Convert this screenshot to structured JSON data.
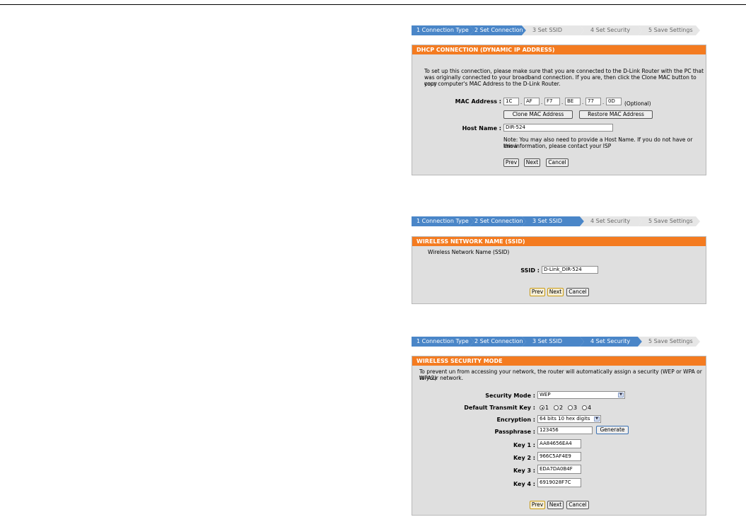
{
  "wizard_steps": [
    "1 Connection Type",
    "2 Set Connection",
    "3 Set SSID",
    "4 Set Security",
    "5 Save Settings"
  ],
  "colors": {
    "accent": "#f47b20",
    "step_active": "#4a86c8",
    "step_inactive": "#e6e6e6",
    "panel_bg": "#dfdfdf"
  },
  "dhcp": {
    "title": "DHCP CONNECTION (DYNAMIC IP ADDRESS)",
    "intro_line1": "To set up this connection, please make sure that you are connected to the D-Link Router with the PC that",
    "intro_line2": "was originally connected to your broadband connection. If you are, then click the Clone MAC button to copy",
    "intro_line3": "your computer's MAC Address to the D-Link Router.",
    "mac_label": "MAC Address :",
    "mac_octets": [
      "1C",
      "AF",
      "F7",
      "BE",
      "77",
      "0D"
    ],
    "optional": "(Optional)",
    "clone_button": "Clone MAC Address",
    "restore_button": "Restore MAC Address",
    "host_label": "Host Name :",
    "host_value": "DIR-524",
    "note_line1": "Note: You may also need to provide a Host Name. If you do not have or know",
    "note_line2": "this information, please contact your ISP",
    "prev": "Prev",
    "next": "Next",
    "cancel": "Cancel"
  },
  "ssid": {
    "title": "WIRELESS NETWORK NAME (SSID)",
    "subtitle": "Wireless Network Name (SSID)",
    "ssid_label": "SSID :",
    "ssid_value": "D-Link_DIR-524",
    "prev": "Prev",
    "next": "Next",
    "cancel": "Cancel"
  },
  "security": {
    "title": "WIRELESS SECURITY MODE",
    "intro_line1": "To prevent un from accessing your network, the router will automatically assign a security (WEP or WPA or WPA2)",
    "intro_line2": "to your network.",
    "mode_label": "Security Mode :",
    "mode_value": "WEP",
    "tx_label": "Default Transmit Key :",
    "tx_options": [
      "1",
      "2",
      "3",
      "4"
    ],
    "tx_selected": "1",
    "enc_label": "Encryption :",
    "enc_value": "64 bits 10 hex digits",
    "pass_label": "Passphrase :",
    "pass_value": "123456",
    "generate": "Generate",
    "key1_label": "Key 1 :",
    "key1_value": "AA84656EA4",
    "key2_label": "Key 2 :",
    "key2_value": "966C5AF4E9",
    "key3_label": "Key 3 :",
    "key3_value": "EDA7DA0B4F",
    "key4_label": "Key 4 :",
    "key4_value": "6919028F7C",
    "prev": "Prev",
    "next": "Next",
    "cancel": "Cancel"
  }
}
